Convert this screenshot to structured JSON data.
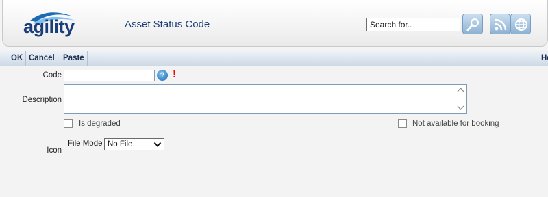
{
  "header": {
    "logo_text": "agility",
    "page_title": "Asset Status Code",
    "search": {
      "placeholder": "Search for..",
      "value": ""
    },
    "buttons": [
      "search-icon",
      "rss-icon",
      "globe-icon"
    ]
  },
  "toolbar": {
    "ok_label": "OK",
    "cancel_label": "Cancel",
    "paste_label": "Paste",
    "help_label": "He"
  },
  "form": {
    "code_label": "Code",
    "code_value": "",
    "description_label": "Description",
    "description_value": "",
    "is_degraded_label": "Is degraded",
    "not_available_label": "Not available for booking",
    "icon_label": "Icon",
    "file_mode_label": "File Mode",
    "file_mode_value": "No File",
    "help_glyph": "?",
    "required_glyph": "!"
  },
  "colors": {
    "brand": "#1b3e7a",
    "accent": "#1b6bb3",
    "required": "#e01010"
  }
}
